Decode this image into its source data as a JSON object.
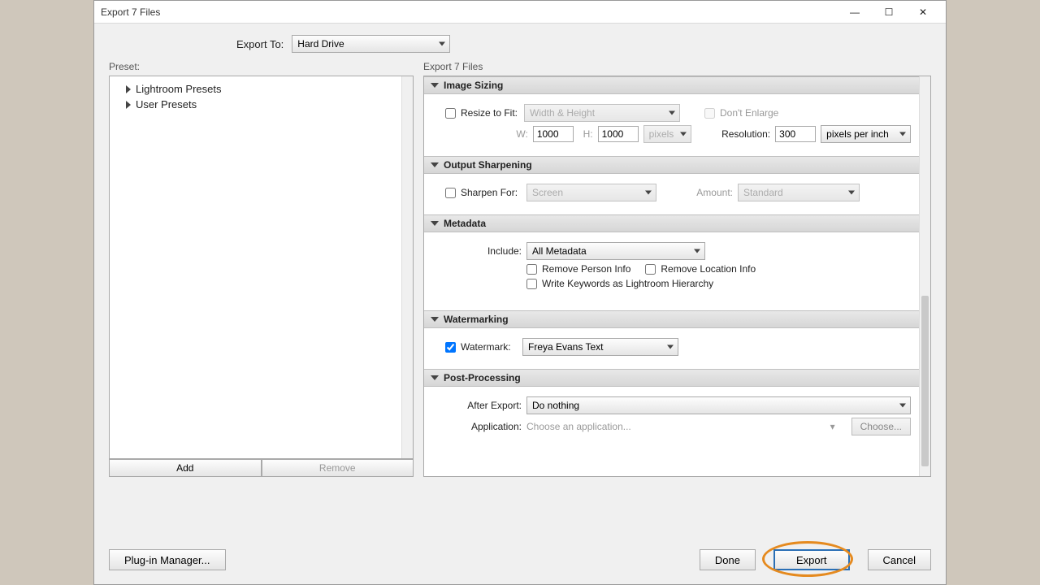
{
  "window": {
    "title": "Export 7 Files"
  },
  "controls": {
    "min": "—",
    "max": "☐",
    "close": "✕"
  },
  "topRow": {
    "label": "Export To:",
    "value": "Hard Drive"
  },
  "preset": {
    "label": "Preset:",
    "items": [
      "Lightroom Presets",
      "User Presets"
    ],
    "add": "Add",
    "remove": "Remove"
  },
  "rightLabel": "Export 7 Files",
  "sections": {
    "sizing": {
      "title": "Image Sizing",
      "resize": "Resize to Fit:",
      "fitMode": "Width & Height",
      "dontEnlarge": "Don't Enlarge",
      "wLabel": "W:",
      "wVal": "1000",
      "hLabel": "H:",
      "hVal": "1000",
      "unit": "pixels",
      "resLabel": "Resolution:",
      "resVal": "300",
      "resUnit": "pixels per inch"
    },
    "sharpen": {
      "title": "Output Sharpening",
      "sharpenFor": "Sharpen For:",
      "screen": "Screen",
      "amountLabel": "Amount:",
      "amount": "Standard"
    },
    "metadata": {
      "title": "Metadata",
      "includeLabel": "Include:",
      "includeVal": "All Metadata",
      "removePerson": "Remove Person Info",
      "removeLoc": "Remove Location Info",
      "hierarchy": "Write Keywords as Lightroom Hierarchy"
    },
    "watermark": {
      "title": "Watermarking",
      "cbLabel": "Watermark:",
      "value": "Freya Evans Text"
    },
    "post": {
      "title": "Post-Processing",
      "afterLabel": "After Export:",
      "afterVal": "Do nothing",
      "appLabel": "Application:",
      "appPlaceholder": "Choose an application...",
      "choose": "Choose..."
    }
  },
  "footer": {
    "plugin": "Plug-in Manager...",
    "done": "Done",
    "export": "Export",
    "cancel": "Cancel"
  }
}
